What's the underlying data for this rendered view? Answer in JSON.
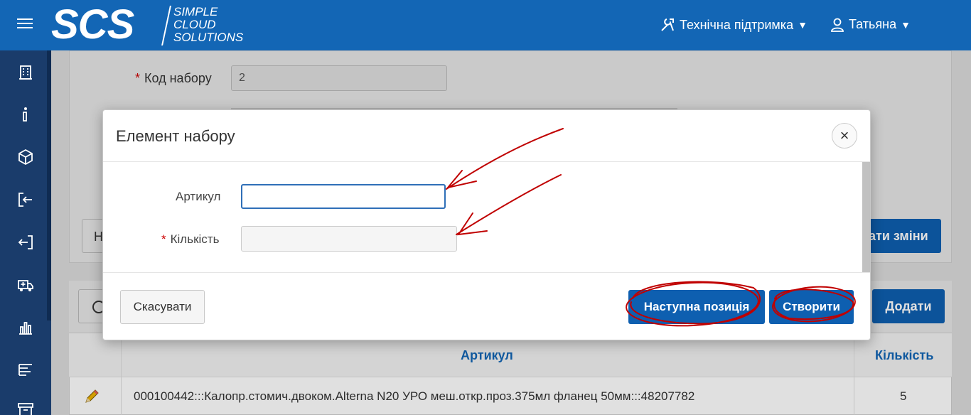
{
  "header": {
    "logo_main": "SCS",
    "logo_sub": [
      "SIMPLE",
      "CLOUD",
      "SOLUTIONS"
    ],
    "support_label": "Технічна підтримка",
    "user_label": "Татьяна",
    "caret": "▼"
  },
  "sidebar": {
    "items": [
      "building-icon",
      "info-icon",
      "box-icon",
      "sign-in-icon",
      "sign-out-icon",
      "ambulance-icon",
      "bar-chart-icon",
      "list-icon",
      "archive-icon"
    ]
  },
  "background": {
    "code_label": "Код набору",
    "code_value": "2",
    "left_button_fragment": "Н",
    "save_button_fragment": "ати зміни",
    "add_button": "Додати"
  },
  "table": {
    "columns": [
      "Артикул",
      "Кількість"
    ],
    "rows": [
      {
        "articul": "000100442:::Калопр.стомич.двоком.Alterna N20 УРО меш.откр.проз.375мл фланец 50мм:::48207782",
        "qty": "5"
      }
    ]
  },
  "modal": {
    "title": "Елемент набору",
    "close": "×",
    "field_articul_label": "Артикул",
    "field_articul_value": "",
    "field_qty_label": "Кількість",
    "field_qty_value": "",
    "required_mark": "*",
    "cancel_button": "Скасувати",
    "next_button": "Наступна позиція",
    "create_button": "Створити"
  },
  "colors": {
    "header_bg": "#1366b5",
    "sidebar_bg": "#1a3c6b",
    "primary_button": "#0e5fb0",
    "annotation": "#c00000"
  }
}
